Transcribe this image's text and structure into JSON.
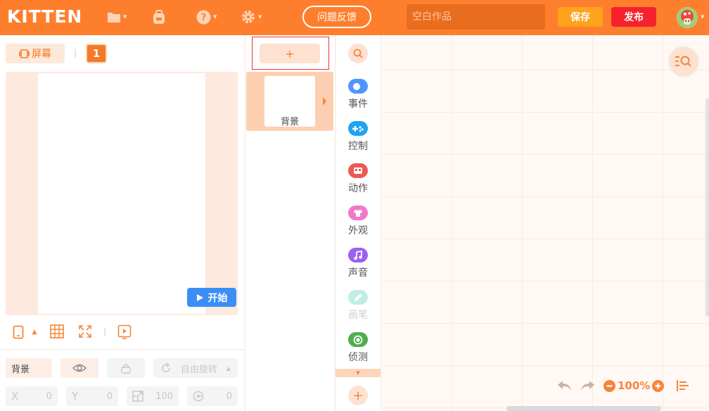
{
  "app": {
    "logo": "KITTEN",
    "feedback_label": "问题反馈",
    "title_placeholder": "空白作品",
    "save_label": "保存",
    "publish_label": "发布"
  },
  "stage": {
    "screen_label": "屏幕",
    "screen_number": "1",
    "start_label": "开始"
  },
  "properties": {
    "name": "背景",
    "rotation_label": "自由旋转",
    "x_label": "X",
    "x_value": "0",
    "y_label": "Y",
    "y_value": "0",
    "size_value": "100",
    "direction_value": "0"
  },
  "sprites": {
    "add_label": "+",
    "background_label": "背景"
  },
  "categories": [
    {
      "label": "事件",
      "color": "#4c97ff"
    },
    {
      "label": "控制",
      "color": "#1fa3f0"
    },
    {
      "label": "动作",
      "color": "#ea5a52"
    },
    {
      "label": "外观",
      "color": "#f07ac8"
    },
    {
      "label": "声音",
      "color": "#9b61f0"
    },
    {
      "label": "画笔",
      "color": "#5fd9c4"
    },
    {
      "label": "侦测",
      "color": "#4caf50"
    }
  ],
  "workspace": {
    "zoom": "100%"
  },
  "colors": {
    "brand": "#fd7f2e",
    "accent": "#f5853a",
    "save": "#ffa21c",
    "publish": "#f5222d",
    "start": "#3a8ef6"
  }
}
